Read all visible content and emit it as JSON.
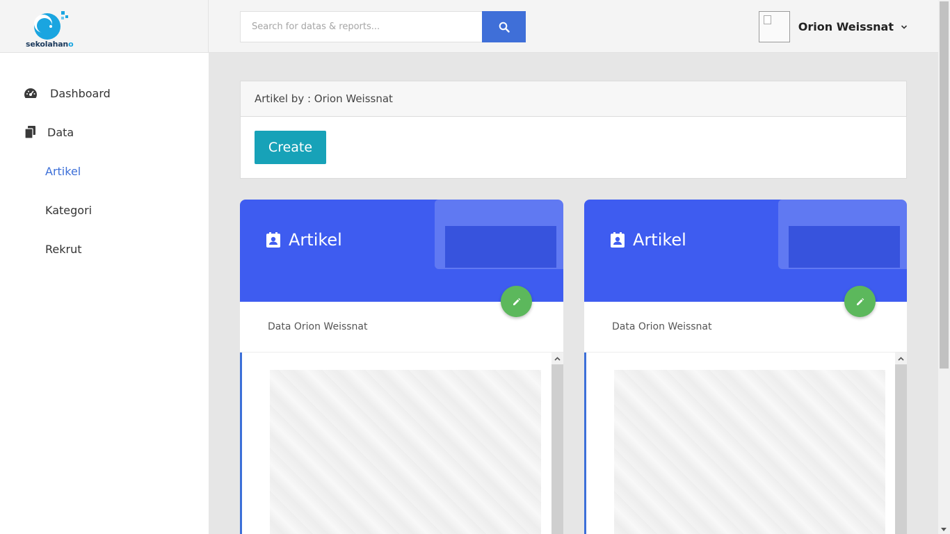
{
  "brand": {
    "logo_main": "sekolahan",
    "logo_accent": "o"
  },
  "sidebar": {
    "items": [
      {
        "label": "Dashboard",
        "icon": "tachometer-icon"
      },
      {
        "label": "Data",
        "icon": "copy-files-icon"
      }
    ],
    "subitems": [
      {
        "label": "Artikel",
        "active": true
      },
      {
        "label": "Kategori",
        "active": false
      },
      {
        "label": "Rekrut",
        "active": false
      }
    ]
  },
  "topbar": {
    "search_placeholder": "Search for datas & reports...",
    "search_icon": "search-icon",
    "user_name": "Orion Weissnat"
  },
  "header_card": {
    "title": "Artikel by : Orion Weissnat",
    "create_label": "Create"
  },
  "cards": [
    {
      "title": "Artikel",
      "subtitle": "Data Orion Weissnat"
    },
    {
      "title": "Artikel",
      "subtitle": "Data Orion Weissnat"
    }
  ],
  "colors": {
    "primary": "#3f6fd8",
    "hero": "#3e5cf0",
    "success": "#5cb85c",
    "info": "#17a2b8"
  }
}
